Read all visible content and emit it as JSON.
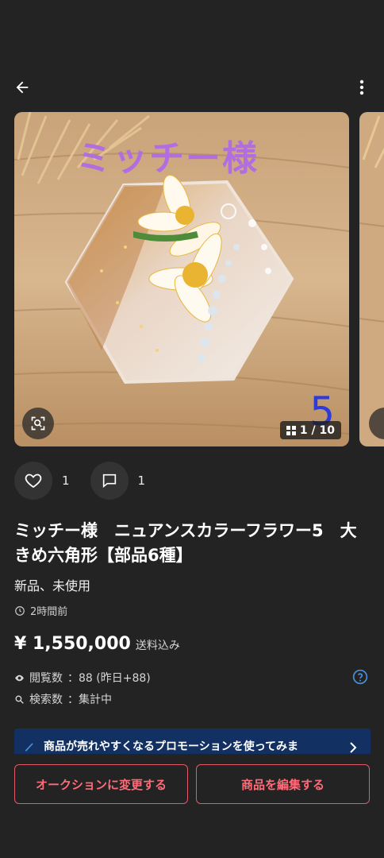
{
  "header": {
    "back_icon": "arrow-left-icon",
    "more_icon": "more-vertical-icon"
  },
  "carousel": {
    "overlay_title": "ミッチー様",
    "overlay_number": "5",
    "counter": "1 / 10",
    "lens_icon": "lens-search-icon"
  },
  "actions": {
    "like_count": "1",
    "comment_count": "1"
  },
  "item": {
    "title": "ミッチー様　ニュアンスカラーフラワー5　大きめ六角形【部品6種】",
    "condition": "新品、未使用",
    "posted_time": "2時間前",
    "price": "¥ 1,550,000",
    "shipping": "送料込み",
    "views_label": "閲覧数",
    "views_value": "：88 (昨日+88)",
    "search_label": "検索数",
    "search_value": "：集計中"
  },
  "promo": {
    "text": "商品が売れやすくなるプロモーションを使ってみま"
  },
  "buttons": {
    "auction": "オークションに変更する",
    "edit": "商品を編集する"
  },
  "colors": {
    "background": "#232323",
    "accent": "#ff6b78",
    "promo_bg": "#123162",
    "help": "#4a90d9"
  }
}
